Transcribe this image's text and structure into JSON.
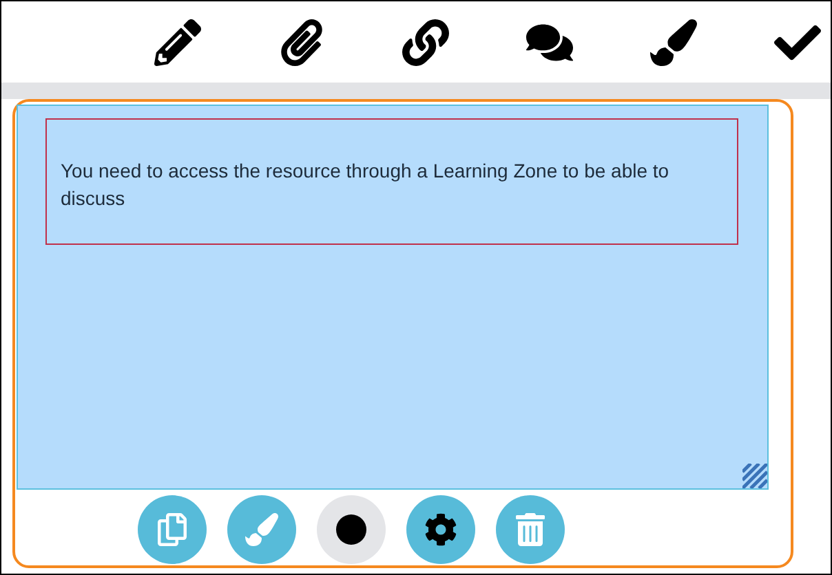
{
  "toolbar": [
    {
      "kind": "pencil"
    },
    {
      "kind": "paperclip"
    },
    {
      "kind": "link"
    },
    {
      "kind": "comments"
    },
    {
      "kind": "brush"
    },
    {
      "kind": "check"
    }
  ],
  "note": {
    "text": "You need to access the resource through a Learning Zone to be able to discuss"
  },
  "actions": [
    {
      "kind": "copy"
    },
    {
      "kind": "brush"
    },
    {
      "kind": "color",
      "color": "#000000"
    },
    {
      "kind": "settings"
    },
    {
      "kind": "trash"
    }
  ]
}
